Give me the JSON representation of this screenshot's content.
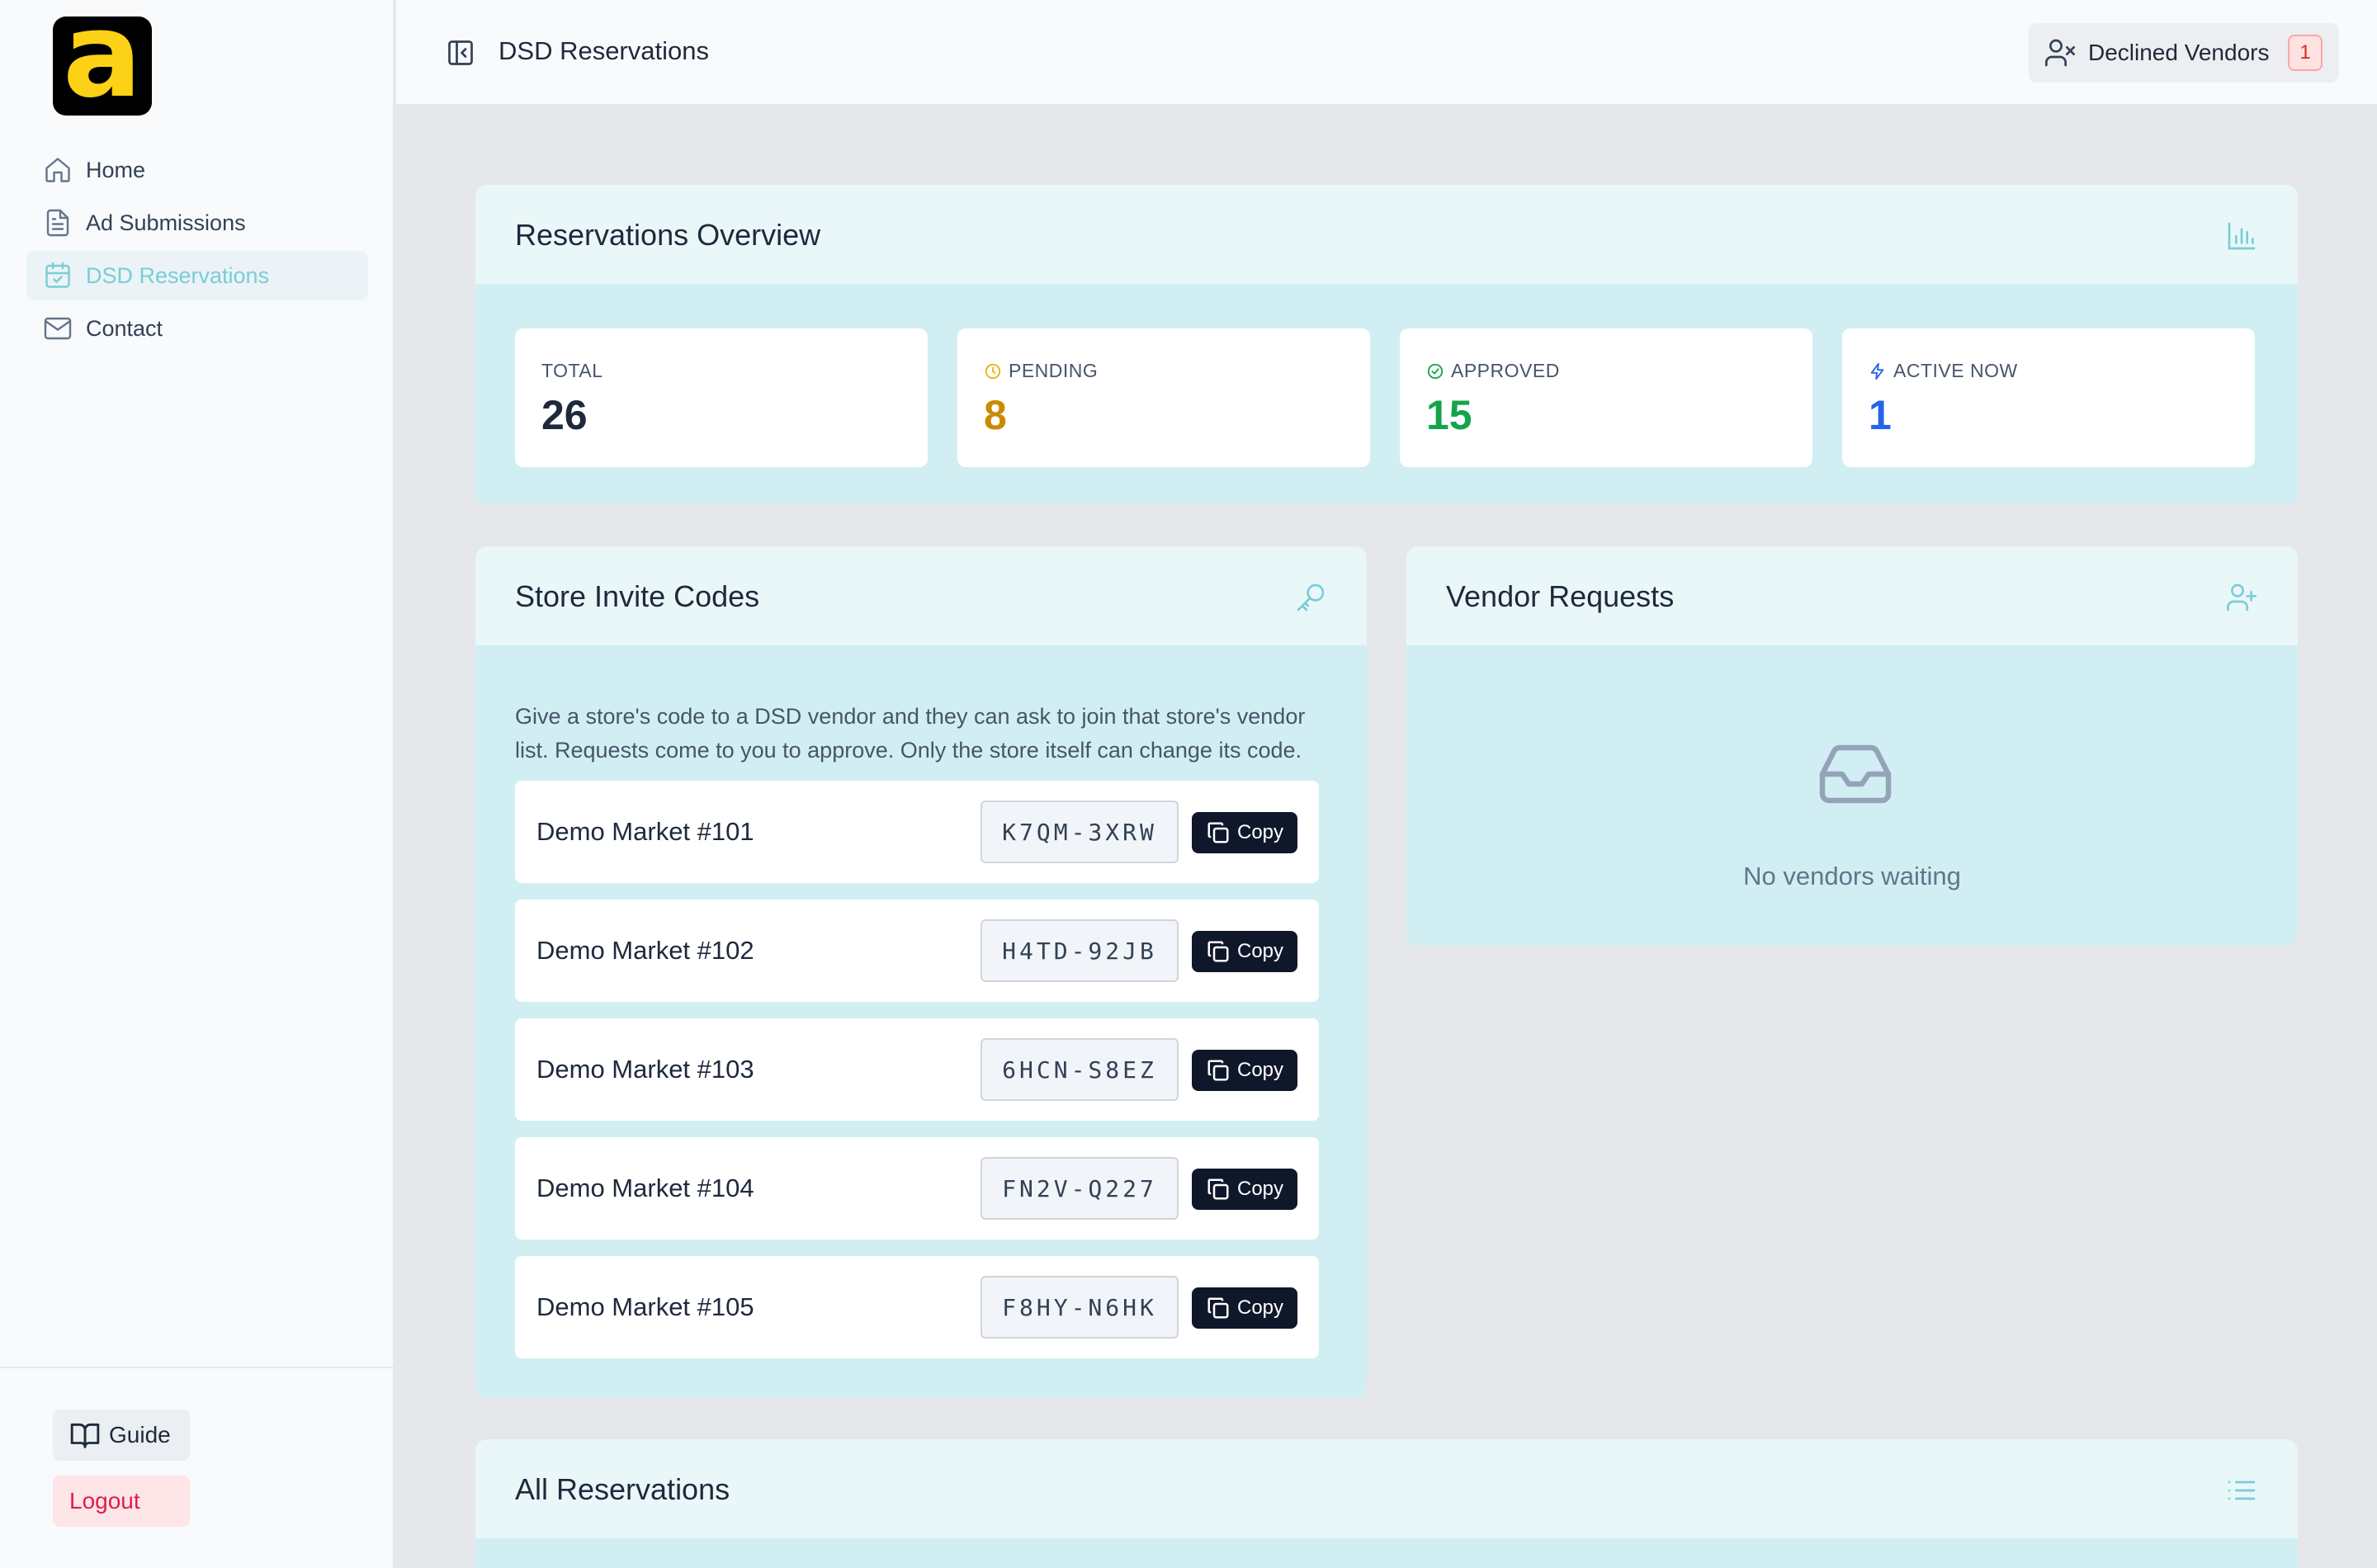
{
  "brand": {
    "logo_letter": "a",
    "logo_bg": "#000000",
    "logo_fg": "#fcd116"
  },
  "sidebar": {
    "items": [
      {
        "label": "Home",
        "icon": "home-icon",
        "active": false
      },
      {
        "label": "Ad Submissions",
        "icon": "file-text-icon",
        "active": false
      },
      {
        "label": "DSD Reservations",
        "icon": "calendar-check-icon",
        "active": true
      },
      {
        "label": "Contact",
        "icon": "mail-icon",
        "active": false
      }
    ],
    "guide_label": "Guide",
    "logout_label": "Logout"
  },
  "header": {
    "title": "DSD Reservations",
    "declined_label": "Declined Vendors",
    "declined_count": "1"
  },
  "overview": {
    "title": "Reservations Overview",
    "stats": [
      {
        "label": "TOTAL",
        "value": "26",
        "color": "#1e293b"
      },
      {
        "label": "PENDING",
        "value": "8",
        "color": "#ca8a04"
      },
      {
        "label": "APPROVED",
        "value": "15",
        "color": "#16a34a"
      },
      {
        "label": "ACTIVE NOW",
        "value": "1",
        "color": "#2563eb"
      }
    ]
  },
  "invite_codes": {
    "title": "Store Invite Codes",
    "description": "Give a store's code to a DSD vendor and they can ask to join that store's vendor list. Requests come to you to approve. Only the store itself can change its code.",
    "copy_label": "Copy",
    "stores": [
      {
        "name": "Demo Market #101",
        "code": "K7QM-3XRW"
      },
      {
        "name": "Demo Market #102",
        "code": "H4TD-92JB"
      },
      {
        "name": "Demo Market #103",
        "code": "6HCN-S8EZ"
      },
      {
        "name": "Demo Market #104",
        "code": "FN2V-Q227"
      },
      {
        "name": "Demo Market #105",
        "code": "F8HY-N6HK"
      }
    ]
  },
  "vendor_requests": {
    "title": "Vendor Requests",
    "empty_text": "No vendors waiting"
  },
  "all_reservations": {
    "title": "All Reservations"
  },
  "colors": {
    "accent": "#79cdd6",
    "card_body": "#d1eff2",
    "card_header": "#eaf7f9"
  }
}
